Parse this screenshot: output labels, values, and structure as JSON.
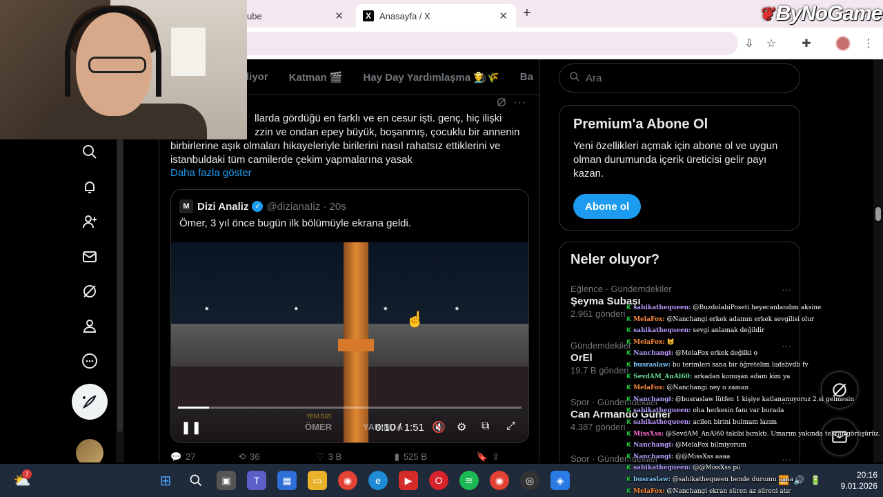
{
  "browser": {
    "tabs": [
      {
        "label": "ube",
        "active": false
      },
      {
        "label": "Anasayfa / X",
        "active": true
      }
    ],
    "new_tab": "+",
    "close_glyph": "✕"
  },
  "overlay": {
    "brand": "ByNoGame"
  },
  "timeline": {
    "tabs": [
      "liyor",
      "Katman 🎬",
      "Hay Day Yardımlaşma 👨‍🌾🌾",
      "Ba"
    ],
    "tweet_header": "s",
    "tweet_text": "llarda gördüğü en farklı ve en cesur işti. genç, hiç ilişki zzin ve ondan epey büyük, boşanmış, çocuklu bir annenin birbirlerine aşık olmaları hikayeleriyle birilerini nasıl rahatsız ettiklerini ve istanbuldaki tüm camilerde çekim yapmalarına yasak",
    "tweet_line1": "llarda gördüğü en farklı ve en cesur işti. genç, hiç ilişki",
    "tweet_line2": "zzin ve ondan epey büyük, boşanmış, çocuklu bir annenin",
    "tweet_line3": "birbirlerine aşık olmaları hikayeleriyle birilerini nasıl rahatsız ettiklerini ve",
    "tweet_line4": "istanbuldaki tüm camilerde çekim yapmalarına yasak",
    "show_more": "Daha fazla göster",
    "quote": {
      "avatar_letter": "M",
      "name": "Dizi Analiz",
      "handle": "@dizianaIiz · 20s",
      "text": "Ömer, 3 yıl önce bugün ilk bölümüyle ekrana geldi.",
      "video": {
        "watermark": "ÖMER",
        "watermark_top": "YENİ DİZİ",
        "watermark_right": "YAKINDA",
        "time": "0:10 / 1:51",
        "progress": 0.09
      }
    },
    "actions": {
      "replies": "27",
      "reposts": "36",
      "likes": "3 B",
      "views": "525 B"
    }
  },
  "right": {
    "search_placeholder": "Ara",
    "premium": {
      "title": "Premium'a Abone Ol",
      "body": "Yeni özellikleri açmak için abone ol ve uygun olman durumunda içerik üreticisi gelir payı kazan.",
      "button": "Abone ol"
    },
    "trends": {
      "title": "Neler oluyor?",
      "items": [
        {
          "category": "Eğlence · Gündemdekiler",
          "name": "Şeyma Subaşı",
          "count": "2.961 gönderi"
        },
        {
          "category": "Gündemdekiler",
          "name": "OrEl",
          "count": "19,7 B gönderi"
        },
        {
          "category": "Spor · Gündemdekiler",
          "name": "Can Armando Güner",
          "count": "4.387 gönderi"
        },
        {
          "category": "Spor · Gündemdekiler",
          "name": "",
          "count": ""
        }
      ]
    }
  },
  "chat": [
    {
      "user": "sahikathequeen:",
      "msg": "@BuzdolabiPoseti heyecanlandım aksine",
      "color": "#b89cff"
    },
    {
      "user": "MelaFox:",
      "msg": "@Nanchangi erkek adamın erkek sevgilisi olur",
      "color": "#ff8c3a"
    },
    {
      "user": "sahikathequeen:",
      "msg": "sevgi anlamak değildir",
      "color": "#b89cff"
    },
    {
      "user": "MelaFox:",
      "msg": "😺",
      "color": "#ff8c3a"
    },
    {
      "user": "Nanchangi:",
      "msg": "@MelaFox erkek değilki o",
      "color": "#b89cff"
    },
    {
      "user": "busraslaw:",
      "msg": "bu terimleri sana bir öğretelim lııdsbvdb fv",
      "color": "#7fc8ff"
    },
    {
      "user": "SevdAM_AnAl60:",
      "msg": "arkadan konuşan adam kim ya",
      "color": "#6ce0a0"
    },
    {
      "user": "MelaFox:",
      "msg": "@Nanchangi ney o zaman",
      "color": "#ff8c3a"
    },
    {
      "user": "Nanchangi:",
      "msg": "@busraslaw lütfen 1 kişiye katlanamıyoruz 2.si gelmesin",
      "color": "#b89cff"
    },
    {
      "user": "sahikathequeen:",
      "msg": "oha herkesin fanı var burada",
      "color": "#b89cff"
    },
    {
      "user": "sahikathequeen:",
      "msg": "acilen birini bulmam lazım",
      "color": "#b89cff"
    },
    {
      "user": "MissXss:",
      "msg": "@SevdAM_AnAl60 takibi bıraktı. Umarım yakında tekrar görüşürüz.",
      "color": "#ff6ad5"
    },
    {
      "user": "Nanchangi:",
      "msg": "@MelaFox bilmiyorum",
      "color": "#b89cff"
    },
    {
      "user": "Nanchangi:",
      "msg": "@@MissXss aaaa",
      "color": "#b89cff"
    },
    {
      "user": "sahikathequeen:",
      "msg": "@@MissXss pü",
      "color": "#b89cff"
    },
    {
      "user": "busraslaw:",
      "msg": "@sahikathequeen bende durumu aaaa",
      "color": "#7fc8ff"
    },
    {
      "user": "MelaFox:",
      "msg": "@Nanchangi ekran süren az süreni atır",
      "color": "#ff8c3a"
    }
  ],
  "taskbar": {
    "weather_badge": "7",
    "time": "20:16",
    "date": "9.01.2026"
  }
}
